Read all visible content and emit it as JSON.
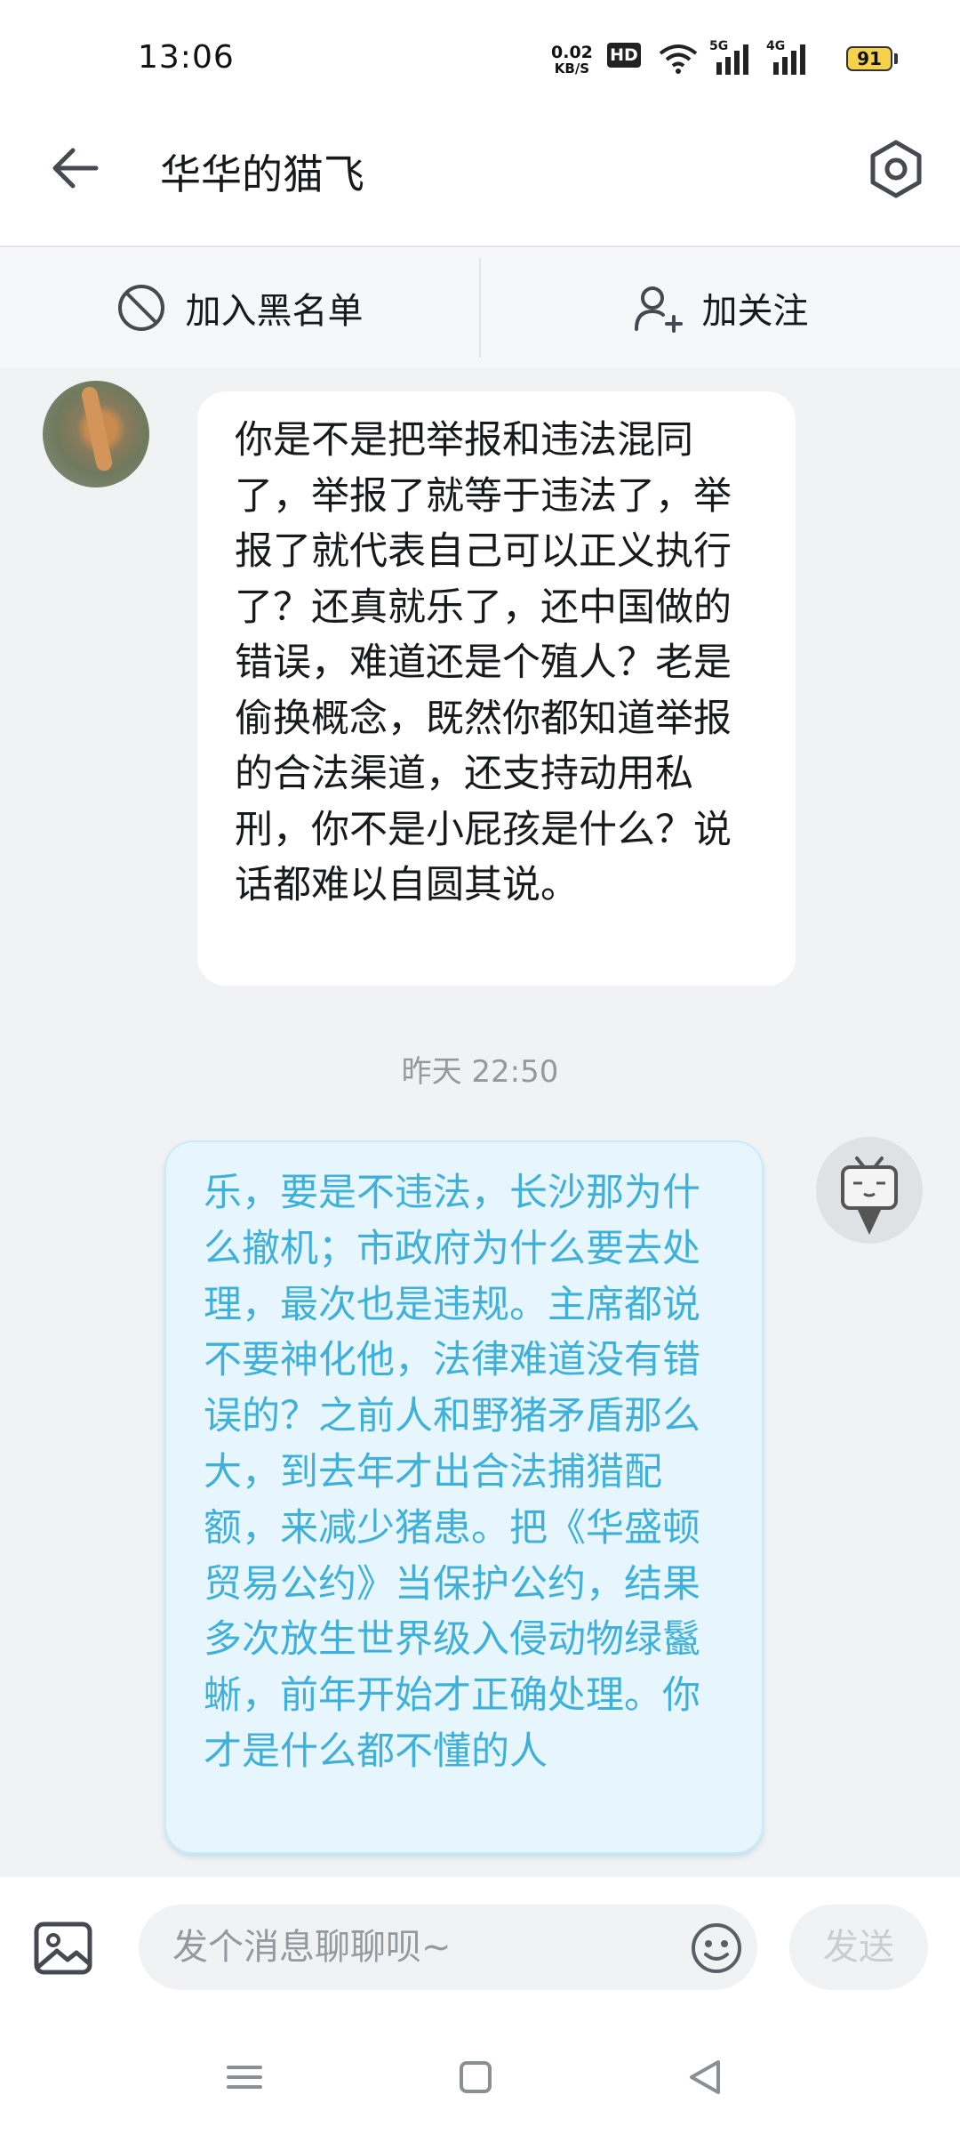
{
  "status_bar": {
    "time": "13:06",
    "net_speed_value": "0.02",
    "net_speed_unit": "KB/S",
    "hd_label": "HD",
    "signal1_label": "5G",
    "signal2_label": "4G",
    "battery": "91"
  },
  "header": {
    "title": "华华的猫飞"
  },
  "actions": {
    "blacklist_label": "加入黑名单",
    "follow_label": "加关注"
  },
  "messages": [
    {
      "side": "left",
      "text": "你是不是把举报和违法混同了，举报了就等于违法了，举报了就代表自己可以正义执行了？还真就乐了，还中国做的错误，难道还是个殖人？老是偷换概念，既然你都知道举报的合法渠道，还支持动用私刑，你不是小屁孩是什么？说话都难以自圆其说。"
    },
    {
      "side": "right",
      "text": "乐，要是不违法，长沙那为什么撤机；市政府为什么要去处理，最次也是违规。主席都说不要神化他，法律难道没有错误的？之前人和野猪矛盾那么大，到去年才出合法捕猎配额，来减少猪患。把《华盛顿贸易公约》当保护公约，结果多次放生世界级入侵动物绿鬣蜥，前年开始才正确处理。你才是什么都不懂的人"
    }
  ],
  "timestamp": "昨天 22:50",
  "input": {
    "placeholder": "发个消息聊聊呗~",
    "value": "",
    "send_label": "发送"
  },
  "colors": {
    "accent_blue": "#3fb0d9",
    "bubble_right_bg": "#e7f6fd",
    "battery": "#f5d24a"
  }
}
